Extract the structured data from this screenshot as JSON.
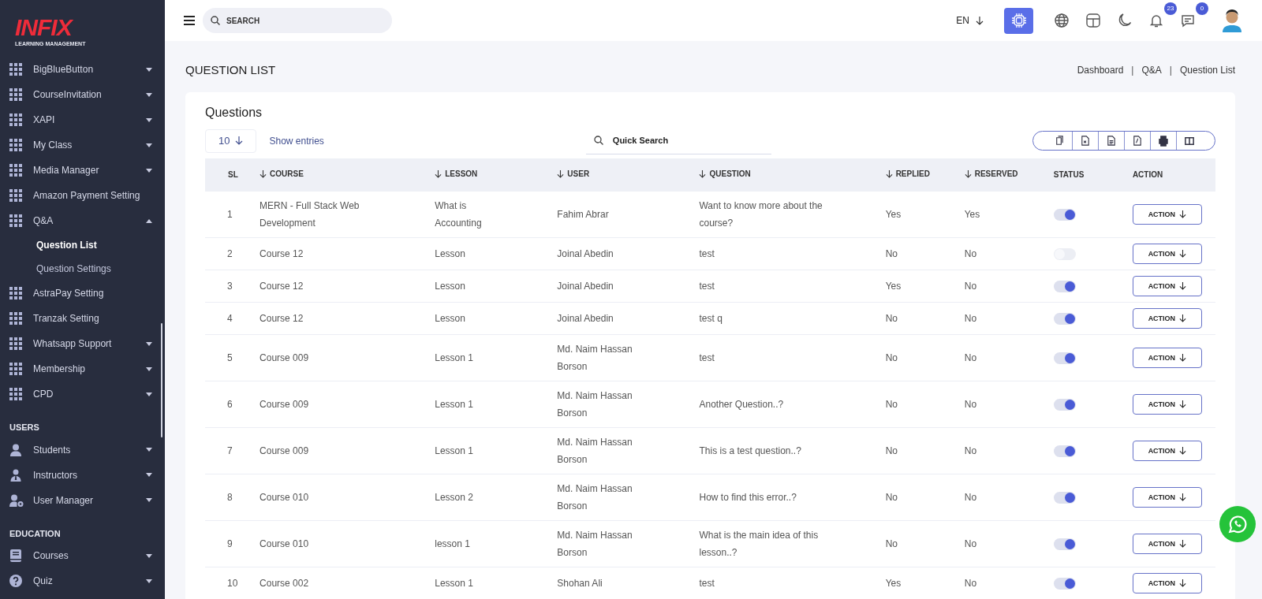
{
  "sidebar": {
    "logo": {
      "name": "INFIX",
      "tagline": "LEARNING MANAGEMENT"
    },
    "sections": [
      {
        "items": [
          {
            "kind": "grid",
            "label": "BigBlueButton",
            "expanded": false
          },
          {
            "kind": "grid",
            "label": "CourseInvitation",
            "expanded": false
          },
          {
            "kind": "grid",
            "label": "XAPI",
            "expanded": false
          },
          {
            "kind": "grid",
            "label": "My Class",
            "expanded": false
          },
          {
            "kind": "grid",
            "label": "Media Manager",
            "expanded": false
          },
          {
            "kind": "grid",
            "label": "Amazon Payment Setting"
          },
          {
            "kind": "grid",
            "label": "Q&A",
            "expanded": true,
            "children": [
              {
                "label": "Question List",
                "selected": true
              },
              {
                "label": "Question Settings",
                "selected": false
              }
            ]
          },
          {
            "kind": "grid",
            "label": "AstraPay Setting"
          },
          {
            "kind": "grid",
            "label": "Tranzak Setting"
          },
          {
            "kind": "grid",
            "label": "Whatsapp Support",
            "expanded": false
          },
          {
            "kind": "grid",
            "label": "Membership",
            "expanded": false
          },
          {
            "kind": "grid",
            "label": "CPD",
            "expanded": false
          }
        ]
      },
      {
        "title": "USERS",
        "items": [
          {
            "kind": "user",
            "label": "Students",
            "expanded": false
          },
          {
            "kind": "instructor",
            "label": "Instructors",
            "expanded": false
          },
          {
            "kind": "user-gear",
            "label": "User Manager",
            "expanded": false
          }
        ]
      },
      {
        "title": "EDUCATION",
        "items": [
          {
            "kind": "book",
            "label": "Courses",
            "expanded": false
          },
          {
            "kind": "question",
            "label": "Quiz",
            "expanded": false
          }
        ]
      }
    ]
  },
  "header": {
    "search": {
      "placeholder": "SEARCH"
    },
    "language": "EN",
    "notifications": "23",
    "messages": "0"
  },
  "page": {
    "title": "QUESTION LIST",
    "breadcrumb": [
      "Dashboard",
      "Q&A",
      "Question List"
    ],
    "breadcrumb_separator": "|"
  },
  "card": {
    "title": "Questions",
    "entries": "10",
    "entries_label": "Show entries",
    "quick_search": {
      "placeholder": "Quick Search"
    },
    "table": {
      "columns": [
        {
          "label": "SL",
          "sortable": false
        },
        {
          "label": "COURSE",
          "sortable": true
        },
        {
          "label": "LESSON",
          "sortable": true
        },
        {
          "label": "USER",
          "sortable": true
        },
        {
          "label": "QUESTION",
          "sortable": true
        },
        {
          "label": "REPLIED",
          "sortable": true
        },
        {
          "label": "RESERVED",
          "sortable": true
        },
        {
          "label": "STATUS",
          "sortable": false
        },
        {
          "label": "ACTION",
          "sortable": false
        }
      ],
      "rows": [
        {
          "sl": "1",
          "course": "MERN - Full Stack Web Development",
          "lesson": "What is Accounting",
          "user": "Fahim Abrar",
          "question": "Want to know more about the course?",
          "replied": "Yes",
          "reserved": "Yes",
          "on": true,
          "action": "ACTION"
        },
        {
          "sl": "2",
          "course": "Course 12",
          "lesson": "Lesson",
          "user": "Joinal Abedin",
          "question": "test",
          "replied": "No",
          "reserved": "No",
          "on": false,
          "action": "ACTION"
        },
        {
          "sl": "3",
          "course": "Course 12",
          "lesson": "Lesson",
          "user": "Joinal Abedin",
          "question": "test",
          "replied": "Yes",
          "reserved": "No",
          "on": true,
          "action": "ACTION"
        },
        {
          "sl": "4",
          "course": "Course 12",
          "lesson": "Lesson",
          "user": "Joinal Abedin",
          "question": "test q",
          "replied": "No",
          "reserved": "No",
          "on": true,
          "action": "ACTION"
        },
        {
          "sl": "5",
          "course": "Course 009",
          "lesson": "Lesson 1",
          "user": "Md. Naim Hassan Borson",
          "question": "test",
          "replied": "No",
          "reserved": "No",
          "on": true,
          "action": "ACTION"
        },
        {
          "sl": "6",
          "course": "Course 009",
          "lesson": "Lesson 1",
          "user": "Md. Naim Hassan Borson",
          "question": "Another Question..?",
          "replied": "No",
          "reserved": "No",
          "on": true,
          "action": "ACTION"
        },
        {
          "sl": "7",
          "course": "Course 009",
          "lesson": "Lesson 1",
          "user": "Md. Naim Hassan Borson",
          "question": "This is a test question..?",
          "replied": "No",
          "reserved": "No",
          "on": true,
          "action": "ACTION"
        },
        {
          "sl": "8",
          "course": "Course 010",
          "lesson": "Lesson 2",
          "user": "Md. Naim Hassan Borson",
          "question": "How to find this error..?",
          "replied": "No",
          "reserved": "No",
          "on": true,
          "action": "ACTION"
        },
        {
          "sl": "9",
          "course": "Course 010",
          "lesson": "lesson 1",
          "user": "Md. Naim Hassan Borson",
          "question": "What is the main idea of this lesson..?",
          "replied": "No",
          "reserved": "No",
          "on": true,
          "action": "ACTION"
        },
        {
          "sl": "10",
          "course": "Course 002",
          "lesson": "Lesson 1",
          "user": "Shohan Ali",
          "question": "test",
          "replied": "Yes",
          "reserved": "No",
          "on": true,
          "action": "ACTION"
        }
      ]
    }
  }
}
